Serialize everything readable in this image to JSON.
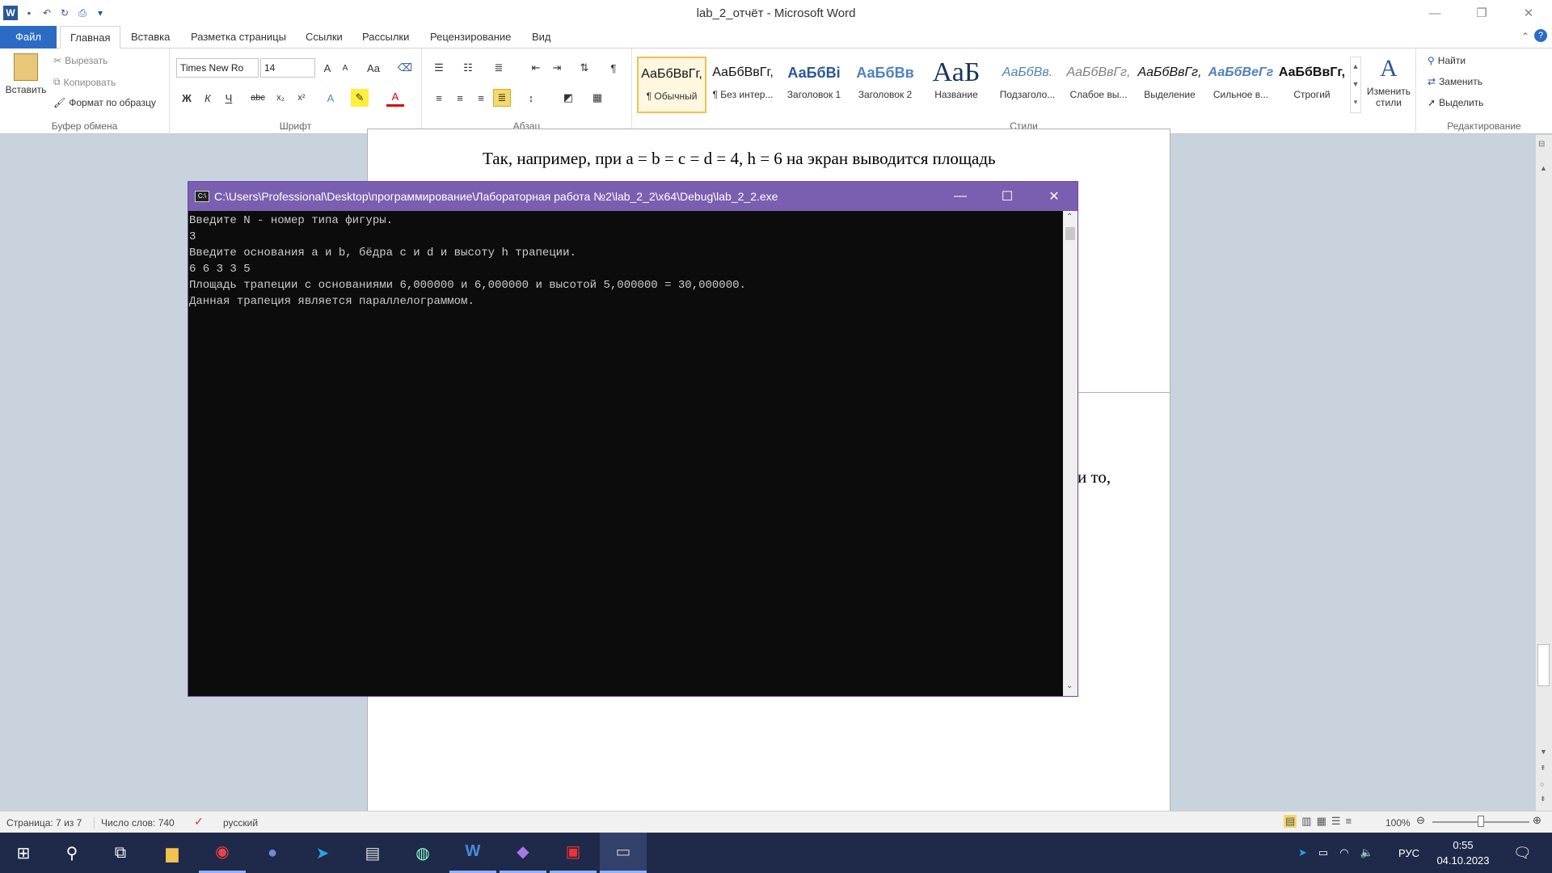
{
  "app": {
    "title": "lab_2_отчёт - Microsoft Word"
  },
  "tabs": [
    "Файл",
    "Главная",
    "Вставка",
    "Разметка страницы",
    "Ссылки",
    "Рассылки",
    "Рецензирование",
    "Вид"
  ],
  "clipboard": {
    "paste": "Вставить",
    "cut": "Вырезать",
    "copy": "Копировать",
    "format_painter": "Формат по образцу",
    "label": "Буфер обмена"
  },
  "font": {
    "name": "Times New Ro",
    "size": "14",
    "label": "Шрифт",
    "bold": "Ж",
    "italic": "К",
    "underline": "Ч",
    "strike": "abc",
    "grow": "A",
    "shrink": "A",
    "case": "Aa"
  },
  "paragraph": {
    "label": "Абзац"
  },
  "styles": {
    "label": "Стили",
    "items": [
      {
        "sample": "АаБбВвГг,",
        "name": "¶ Обычный"
      },
      {
        "sample": "АаБбВвГг,",
        "name": "¶ Без интер..."
      },
      {
        "sample": "АаБбВі",
        "name": "Заголовок 1"
      },
      {
        "sample": "АаБбВв",
        "name": "Заголовок 2"
      },
      {
        "sample": "АаБ",
        "name": "Название"
      },
      {
        "sample": "АаБбВв.",
        "name": "Подзаголо..."
      },
      {
        "sample": "АаБбВвГг,",
        "name": "Слабое вы..."
      },
      {
        "sample": "АаБбВвГг,",
        "name": "Выделение"
      },
      {
        "sample": "АаБбВеГг",
        "name": "Сильное в..."
      },
      {
        "sample": "АаБбВвГг,",
        "name": "Строгий"
      }
    ],
    "change": "Изменить стили"
  },
  "editing": {
    "label": "Редактирование",
    "find": "Найти",
    "replace": "Заменить",
    "select": "Выделить"
  },
  "document": {
    "line1": "Так, например, при a = b = c = d = 4, h = 6 на экран выводится площадь",
    "line2_fragment": "и то,"
  },
  "console": {
    "title": "C:\\Users\\Professional\\Desktop\\программирование\\Лабораторная работа №2\\lab_2_2\\x64\\Debug\\lab_2_2.exe",
    "lines": [
      "Введите N - номер типа фигуры.",
      "3",
      "Введите основания a и b, бёдра c и d и высоту h трапеции.",
      "6 6 3 3 5",
      "Площадь трапеции с основаниями 6,000000 и 6,000000 и высотой 5,000000 = 30,000000.",
      "Данная трапеция является параллелограммом."
    ]
  },
  "status": {
    "page": "Страница: 7 из 7",
    "words": "Число слов: 740",
    "language": "русский",
    "zoom": "100%"
  },
  "tray": {
    "lang": "РУС",
    "time": "0:55",
    "date": "04.10.2023"
  }
}
